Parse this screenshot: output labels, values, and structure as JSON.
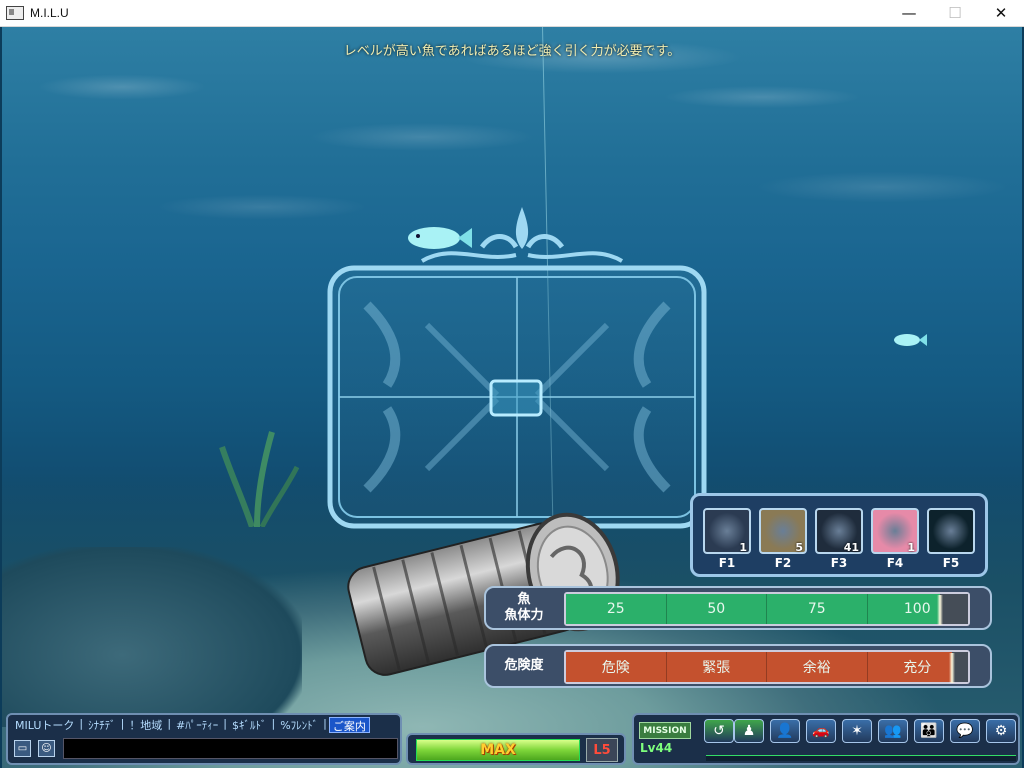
{
  "window": {
    "title": "M.I.L.U",
    "minimize_glyph": "—",
    "maximize_glyph": "☐",
    "close_glyph": "✕"
  },
  "hint_text": "レベルが高い魚であればあるほど強く引く力が必要です。",
  "skills": [
    {
      "key": "F1",
      "count": "1",
      "icon": "compass-star-icon",
      "color": "#2b3b52"
    },
    {
      "key": "F2",
      "count": "5",
      "icon": "glowing-orb-icon",
      "color": "#8a7a55"
    },
    {
      "key": "F3",
      "count": "41",
      "icon": "dark-orb-icon",
      "color": "#1f2c3c"
    },
    {
      "key": "F4",
      "count": "1",
      "icon": "heart-icon",
      "color": "#e68aa8"
    },
    {
      "key": "F5",
      "count": "",
      "icon": "empty-slot",
      "color": "#0d222c"
    }
  ],
  "fish_stamina": {
    "label_line1": "魚",
    "label_line2": "魚体力",
    "ticks": [
      "25",
      "50",
      "75",
      "100"
    ],
    "color": "#2bb06a",
    "level": 0.93
  },
  "danger": {
    "label": "危険度",
    "ticks": [
      "危険",
      "緊張",
      "余裕",
      "充分"
    ],
    "color": "#c4512e",
    "level": 0.96
  },
  "chat": {
    "tabs": [
      "MILUトーク",
      "ｼﾅﾁﾃﾞ",
      "！地域",
      "#ﾊﾟｰﾃｨｰ",
      "$ｷﾞﾙﾄﾞ",
      "%ﾌﾚﾝﾄﾞ",
      "ご案内"
    ],
    "active_tab": "ご案内",
    "input_value": ""
  },
  "power": {
    "label": "MAX",
    "level_badge": "L5"
  },
  "status": {
    "mission_label": "MISSION",
    "level": "Lv44"
  },
  "menu_icons": [
    {
      "name": "return-icon",
      "glyph": "↺",
      "color": "#3fa64a"
    },
    {
      "name": "walk-icon",
      "glyph": "♟",
      "color": "#3fa64a"
    },
    {
      "name": "character-icon",
      "glyph": "👤",
      "color": "#3a6ea8"
    },
    {
      "name": "vehicle-icon",
      "glyph": "🚗",
      "color": "#3a6ea8"
    },
    {
      "name": "skill-icon",
      "glyph": "✶",
      "color": "#3a6ea8"
    },
    {
      "name": "party-add-icon",
      "glyph": "👥",
      "color": "#3a6ea8"
    },
    {
      "name": "friends-icon",
      "glyph": "👪",
      "color": "#3a6ea8"
    },
    {
      "name": "chat-bubble-icon",
      "glyph": "💬",
      "color": "#3a6ea8"
    },
    {
      "name": "settings-gear-icon",
      "glyph": "⚙",
      "color": "#3a6ea8"
    }
  ]
}
